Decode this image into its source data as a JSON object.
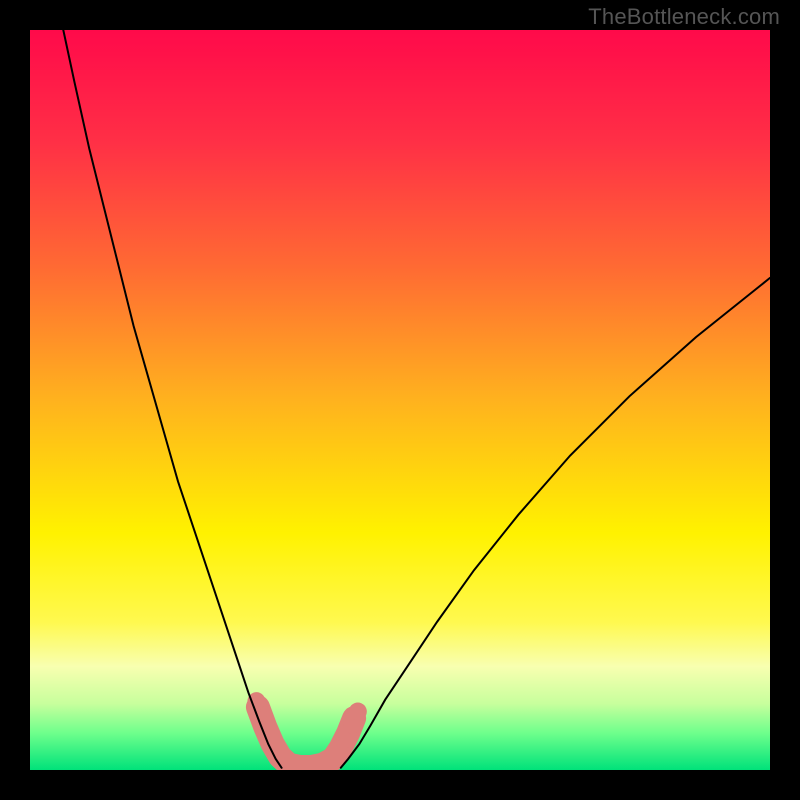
{
  "watermark": "TheBottleneck.com",
  "chart_data": {
    "type": "line",
    "title": "",
    "xlabel": "",
    "ylabel": "",
    "xlim": [
      0,
      100
    ],
    "ylim": [
      0,
      100
    ],
    "background_gradient": {
      "stops": [
        {
          "offset": 0.0,
          "color": "#ff0a4a"
        },
        {
          "offset": 0.15,
          "color": "#ff2f46"
        },
        {
          "offset": 0.32,
          "color": "#ff6a33"
        },
        {
          "offset": 0.5,
          "color": "#ffb21e"
        },
        {
          "offset": 0.68,
          "color": "#fff200"
        },
        {
          "offset": 0.8,
          "color": "#fff94f"
        },
        {
          "offset": 0.86,
          "color": "#f8ffb0"
        },
        {
          "offset": 0.91,
          "color": "#c8ff9d"
        },
        {
          "offset": 0.95,
          "color": "#6eff8c"
        },
        {
          "offset": 1.0,
          "color": "#00e27a"
        }
      ]
    },
    "series": [
      {
        "name": "left-curve",
        "color": "#000000",
        "stroke_width": 2,
        "x": [
          4.5,
          6,
          8,
          10,
          12,
          14,
          16,
          18,
          20,
          22,
          24,
          26,
          28,
          29.5,
          31,
          32.2,
          33.2,
          34
        ],
        "y": [
          100,
          93,
          84,
          76,
          68,
          60,
          53,
          46,
          39,
          33,
          27,
          21,
          15,
          10.5,
          6.5,
          3.5,
          1.5,
          0.3
        ]
      },
      {
        "name": "right-curve",
        "color": "#000000",
        "stroke_width": 2,
        "x": [
          42,
          43,
          44.5,
          46,
          48,
          51,
          55,
          60,
          66,
          73,
          81,
          90,
          100
        ],
        "y": [
          0.3,
          1.5,
          3.5,
          6,
          9.5,
          14,
          20,
          27,
          34.5,
          42.5,
          50.5,
          58.5,
          66.5
        ]
      },
      {
        "name": "bottom-pink-shape",
        "type": "area",
        "color": "#dd7f7a",
        "x": [
          30.5,
          31.5,
          32.3,
          33,
          34,
          35,
          36.5,
          38,
          39.5,
          41,
          42,
          42.8,
          43.5,
          44.2,
          43.5,
          42.8,
          42,
          41,
          39.5,
          38,
          36.5,
          35,
          34,
          33,
          32,
          31,
          30,
          30.5
        ],
        "y": [
          9.2,
          6.5,
          4.3,
          2.5,
          1.1,
          0.4,
          0.25,
          0.25,
          0.4,
          1.0,
          2.2,
          4.0,
          6.0,
          7.8,
          5.2,
          3.2,
          1.4,
          0.3,
          -0.1,
          -0.1,
          -0.1,
          -0.1,
          0.2,
          1.2,
          2.8,
          5.0,
          8.0,
          9.2
        ]
      }
    ],
    "markers": {
      "name": "pink-dots",
      "color": "#dd7f7a",
      "radius": 9,
      "points": [
        {
          "x": 30.6,
          "y": 9.3
        },
        {
          "x": 31.6,
          "y": 6.8
        },
        {
          "x": 42.9,
          "y": 4.2
        },
        {
          "x": 43.6,
          "y": 6.1
        },
        {
          "x": 44.3,
          "y": 7.9
        }
      ]
    }
  }
}
